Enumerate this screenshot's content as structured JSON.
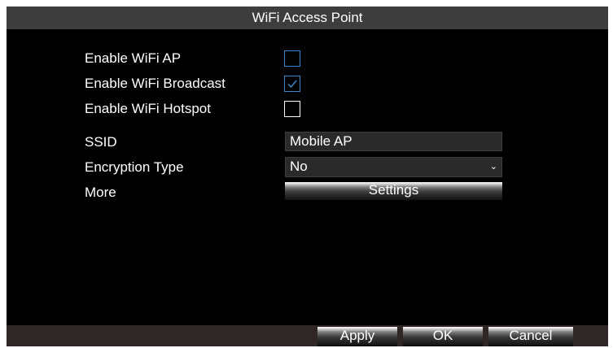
{
  "window": {
    "title": "WiFi Access Point"
  },
  "form": {
    "enable_ap": {
      "label": "Enable WiFi AP",
      "checked": false
    },
    "enable_broadcast": {
      "label": "Enable WiFi Broadcast",
      "checked": true
    },
    "enable_hotspot": {
      "label": "Enable WiFi Hotspot",
      "checked": false
    },
    "ssid": {
      "label": "SSID",
      "value": "Mobile AP"
    },
    "encryption": {
      "label": "Encryption Type",
      "value": "No"
    },
    "more": {
      "label": "More",
      "button_label": "Settings"
    }
  },
  "footer": {
    "apply_label": "Apply",
    "ok_label": "OK",
    "cancel_label": "Cancel"
  },
  "colors": {
    "background": "#000000",
    "title_bar": "#3d3d3d",
    "footer_bar": "#2e2726",
    "checkbox_accent": "#3a86c8",
    "text": "#ffffff"
  },
  "icons": {
    "checkmark": "check-icon",
    "dropdown": "chevron-down-icon"
  }
}
